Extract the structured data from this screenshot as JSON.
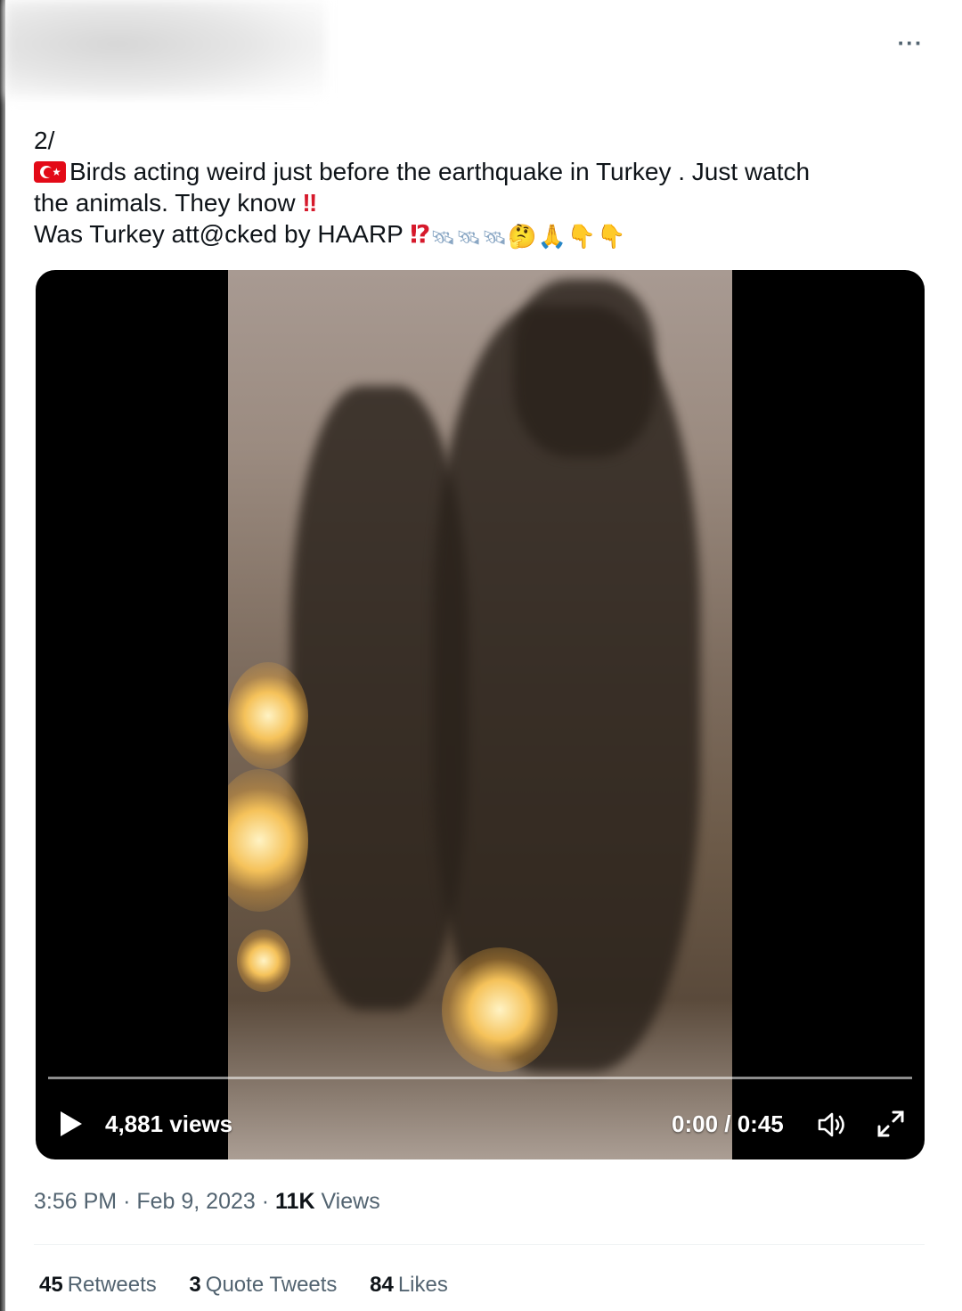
{
  "header": {
    "more_label": "···"
  },
  "tweet": {
    "thread_index": "2/",
    "line1": "Birds acting weird just before the earthquake in Turkey . Just watch",
    "line2": "the animals. They know",
    "line2_emoji": "‼",
    "line3": "Was Turkey att@cked by HAARP",
    "line3_emoji": "⁉",
    "flag_icon": "turkey-flag-icon",
    "trailing_emojis": [
      {
        "name": "satellite-icon",
        "glyph": "🛰"
      },
      {
        "name": "satellite-icon",
        "glyph": "🛰"
      },
      {
        "name": "satellite-icon",
        "glyph": "🛰"
      },
      {
        "name": "thinking-face-icon",
        "glyph": "🤔"
      },
      {
        "name": "folded-hands-icon",
        "glyph": "🙏"
      },
      {
        "name": "point-down-icon",
        "glyph": "👇"
      },
      {
        "name": "point-down-icon",
        "glyph": "👇"
      }
    ]
  },
  "video": {
    "views": "4,881 views",
    "time": "0:00 / 0:45",
    "progress": 0
  },
  "meta": {
    "time": "3:56 PM",
    "date": "Feb 9, 2023",
    "views_count": "11K",
    "views_label": "Views",
    "separator": "·"
  },
  "stats": {
    "retweets_count": "45",
    "retweets_label": "Retweets",
    "quotes_count": "3",
    "quotes_label": "Quote Tweets",
    "likes_count": "84",
    "likes_label": "Likes"
  },
  "colors": {
    "text": "#0f1419",
    "secondary": "#536471",
    "accent_red": "#d6192b",
    "flag_red": "#e30a17"
  }
}
